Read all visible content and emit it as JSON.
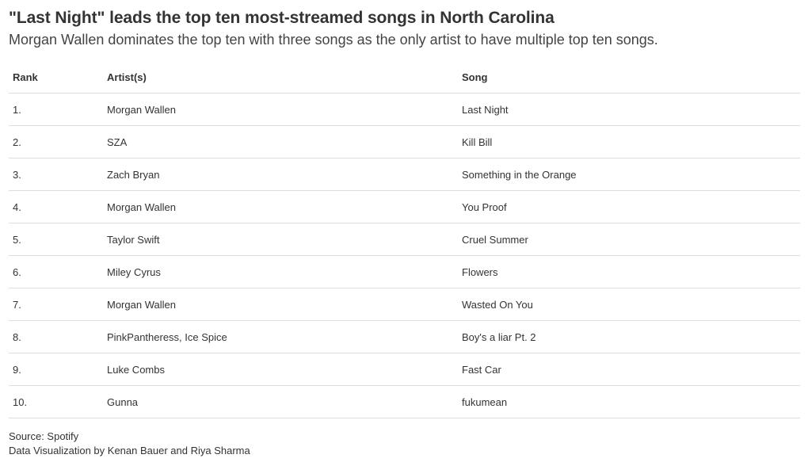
{
  "header": {
    "title": "\"Last Night\" leads the top ten most-streamed songs in North Carolina",
    "subtitle": "Morgan Wallen dominates the top ten with three songs as the only artist to have multiple top ten songs."
  },
  "table": {
    "columns": [
      "Rank",
      "Artist(s)",
      "Song"
    ],
    "rows": [
      [
        "1.",
        "Morgan Wallen",
        "Last Night"
      ],
      [
        "2.",
        "SZA",
        "Kill Bill"
      ],
      [
        "3.",
        "Zach Bryan",
        "Something in the Orange"
      ],
      [
        "4.",
        "Morgan Wallen",
        "You Proof"
      ],
      [
        "5.",
        "Taylor Swift",
        "Cruel Summer"
      ],
      [
        "6.",
        "Miley Cyrus",
        "Flowers"
      ],
      [
        "7.",
        "Morgan Wallen",
        "Wasted On You"
      ],
      [
        "8.",
        "PinkPantheress, Ice Spice",
        "Boy's a liar Pt. 2"
      ],
      [
        "9.",
        "Luke Combs",
        "Fast Car"
      ],
      [
        "10.",
        "Gunna",
        "fukumean"
      ]
    ]
  },
  "footer": {
    "source": "Source: Spotify",
    "credit": "Data Visualization by Kenan Bauer and Riya Sharma"
  }
}
